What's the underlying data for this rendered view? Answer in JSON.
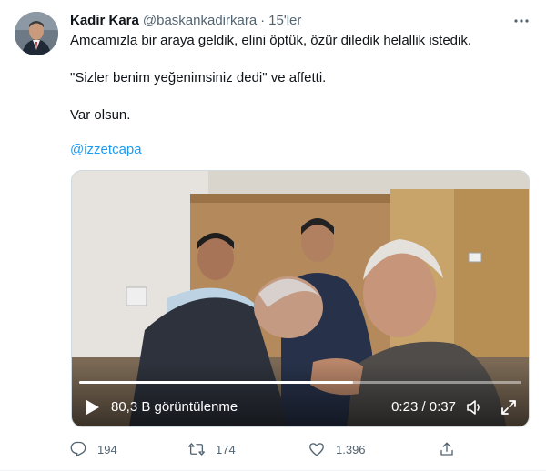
{
  "tweet": {
    "author_name": "Kadir Kara",
    "author_handle": "@baskankadirkara",
    "separator": "·",
    "time": "15'ler",
    "lines": [
      "Amcamızla bir araya geldik, elini öptük, özür diledik helallik istedik.",
      "\"Sizler benim yeğenimsiniz dedi\" ve affetti.",
      "Var olsun."
    ],
    "mention": "@izzetcapa"
  },
  "video": {
    "views": "80,3 B görüntülenme",
    "timecode": "0:23 / 0:37",
    "progress": 0.62
  },
  "actions": {
    "reply_count": "194",
    "retweet_count": "174",
    "like_count": "1.396"
  },
  "icons": {
    "more": "more-horizontal-icon",
    "reply": "reply-icon",
    "retweet": "retweet-icon",
    "like": "heart-icon",
    "share": "share-icon",
    "play": "play-icon",
    "volume": "volume-icon",
    "fullscreen": "fullscreen-icon"
  },
  "colors": {
    "text": "#0f1419",
    "secondary": "#536471",
    "link": "#1d9bf0"
  }
}
